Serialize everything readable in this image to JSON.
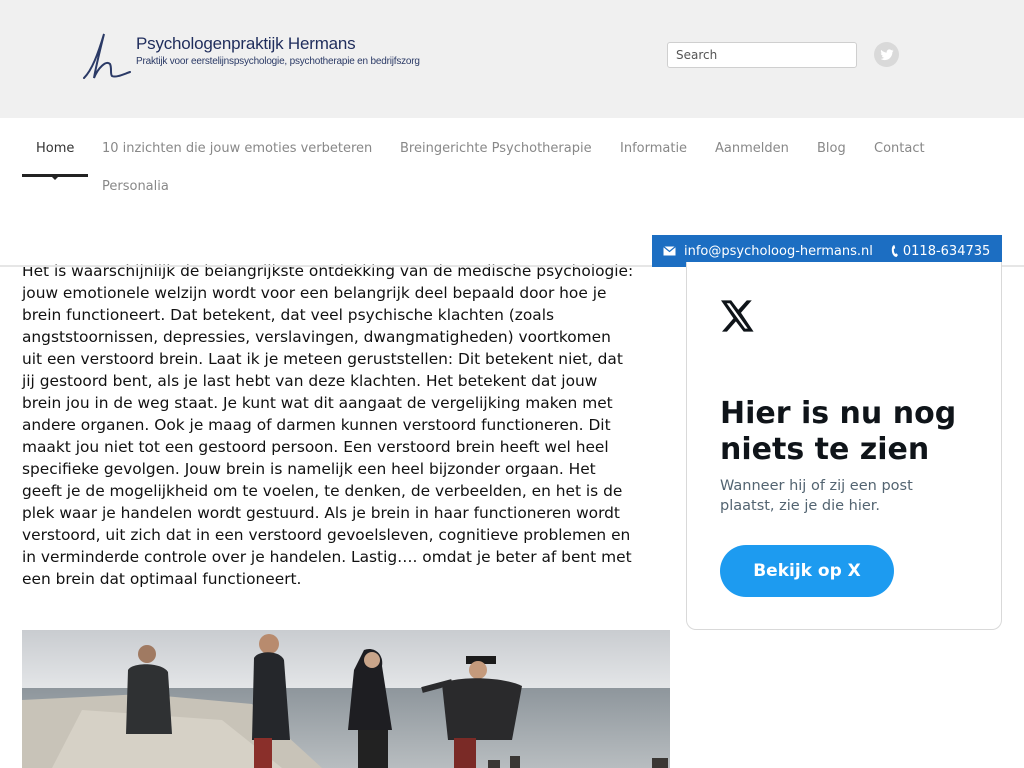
{
  "header": {
    "logo_title": "Psychologenpraktijk Hermans",
    "logo_subtitle": "Praktijk voor eerstelijnspsychologie, psychotherapie en bedrijfszorg",
    "search_placeholder": "Search"
  },
  "nav": {
    "items": [
      {
        "label": "Home",
        "active": true
      },
      {
        "label": "10 inzichten die jouw emoties verbeteren"
      },
      {
        "label": "Breingerichte Psychotherapie"
      },
      {
        "label": "Informatie"
      },
      {
        "label": "Aanmelden"
      },
      {
        "label": "Blog"
      },
      {
        "label": "Contact"
      },
      {
        "label": "Personalia"
      }
    ]
  },
  "contact": {
    "email": "info@psycholoog-hermans.nl",
    "phone": "0118-634735"
  },
  "main": {
    "lines": [
      "Het is waarschijnlijk de belangrijkste ontdekking van de medische psychologie:",
      "jouw emotionele welzijn wordt voor een belangrijk deel bepaald door hoe je",
      "brein functioneert. Dat betekent, dat veel psychische klachten (zoals",
      "angststoornissen, depressies, verslavingen, dwangmatigheden) voortkomen",
      "uit een verstoord brein. Laat ik je meteen geruststellen: Dit betekent niet, dat",
      "jij gestoord bent, als je last hebt van deze klachten. Het betekent dat jouw",
      "brein jou in de weg staat. Je kunt wat dit aangaat de vergelijking maken met",
      "andere organen. Ook je maag of darmen kunnen verstoord functioneren. Dit",
      "maakt jou niet tot een gestoord persoon. Een verstoord brein heeft wel heel",
      "specifieke gevolgen. Jouw brein is namelijk een heel bijzonder orgaan. Het",
      "geeft je de mogelijkheid om te voelen, te denken, de verbeelden, en het is de",
      "plek waar je handelen wordt gestuurd. Als je brein in haar functioneren wordt",
      "verstoord, uit zich dat in een verstoord gevoelsleven, cognitieve problemen en",
      "in verminderde controle over je handelen. Lastig…. omdat je beter af bent met",
      "een brein dat optimaal functioneert."
    ]
  },
  "x_widget": {
    "heading": "Hier is nu nog niets te zien",
    "subtext": "Wanneer hij of zij een post plaatst, zie je die hier.",
    "button_label": "Bekijk op X"
  },
  "colors": {
    "accent": "#1c6ec2",
    "x_button": "#1d9bf0",
    "header_bg": "#f0f0f0"
  }
}
